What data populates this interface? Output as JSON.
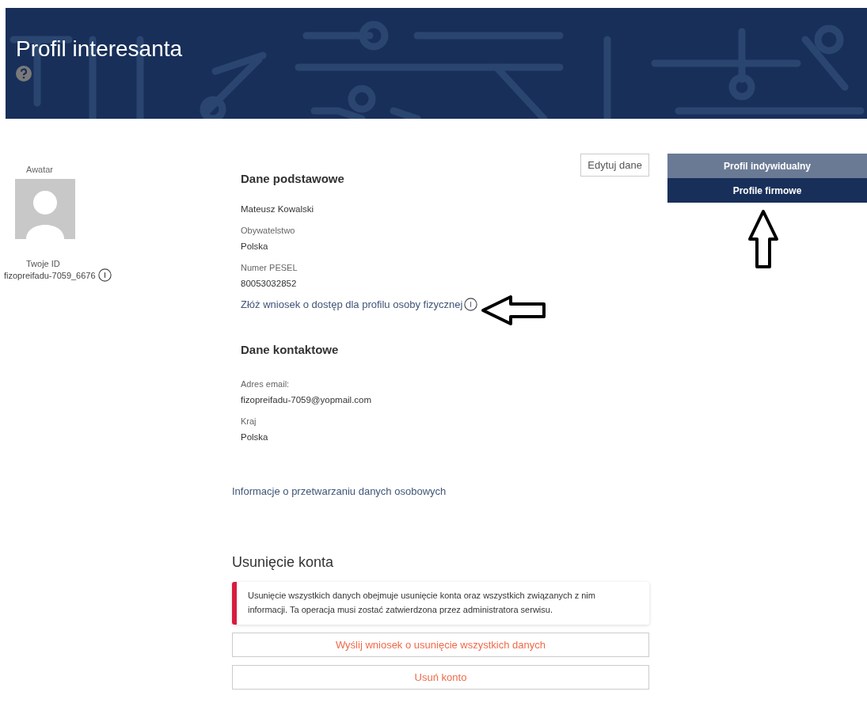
{
  "header": {
    "title": "Profil interesanta"
  },
  "avatar": {
    "label": "Awatar",
    "id_label": "Twoje ID",
    "id_value": "fizopreifadu-7059_6676"
  },
  "edit_button": "Edytuj dane",
  "basic": {
    "heading": "Dane podstawowe",
    "name": "Mateusz Kowalski",
    "fields": [
      {
        "label": "Obywatelstwo",
        "value": "Polska"
      },
      {
        "label": "Numer PESEL",
        "value": "80053032852"
      }
    ],
    "link": "Złóż wniosek o dostęp dla profilu osoby fizycznej"
  },
  "contact": {
    "heading": "Dane kontaktowe",
    "fields": [
      {
        "label": "Adres email:",
        "value": "fizopreifadu-7059@yopmail.com"
      },
      {
        "label": "Kraj",
        "value": "Polska"
      }
    ]
  },
  "privacy_link": "Informacje o przetwarzaniu danych osobowych",
  "deletion": {
    "heading": "Usunięcie konta",
    "warning": "Usunięcie wszystkich danych obejmuje usunięcie konta oraz wszystkich związanych z nim informacji. Ta operacja musi zostać zatwierdzona przez administratora serwisu.",
    "buttons": [
      "Wyślij wniosek o usunięcie wszystkich danych",
      "Usuń konto"
    ]
  },
  "profile_tabs": [
    {
      "label": "Profil indywidualny",
      "selected": true
    },
    {
      "label": "Profile firmowe",
      "selected": false
    }
  ]
}
